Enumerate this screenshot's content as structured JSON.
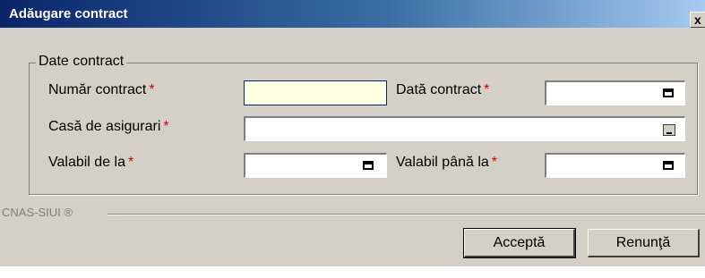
{
  "window": {
    "title": "Adăugare contract",
    "close_label": "x"
  },
  "group": {
    "legend": "Date contract"
  },
  "fields": {
    "numar_contract": {
      "label": "Număr contract",
      "value": ""
    },
    "data_contract": {
      "label": "Dată contract",
      "value": ""
    },
    "casa_asigurari": {
      "label": "Casă de asigurari",
      "value": ""
    },
    "valabil_de_la": {
      "label": "Valabil de la",
      "value": ""
    },
    "valabil_pana_la": {
      "label": "Valabil până la",
      "value": ""
    }
  },
  "required_marker": "*",
  "footer": {
    "brand": "CNAS-SIUI ®"
  },
  "buttons": {
    "accept": "Acceptă",
    "cancel": "Renunţă"
  },
  "icons": {
    "date_picker": "calendar-icon",
    "browse": "ellipsis-icon"
  }
}
